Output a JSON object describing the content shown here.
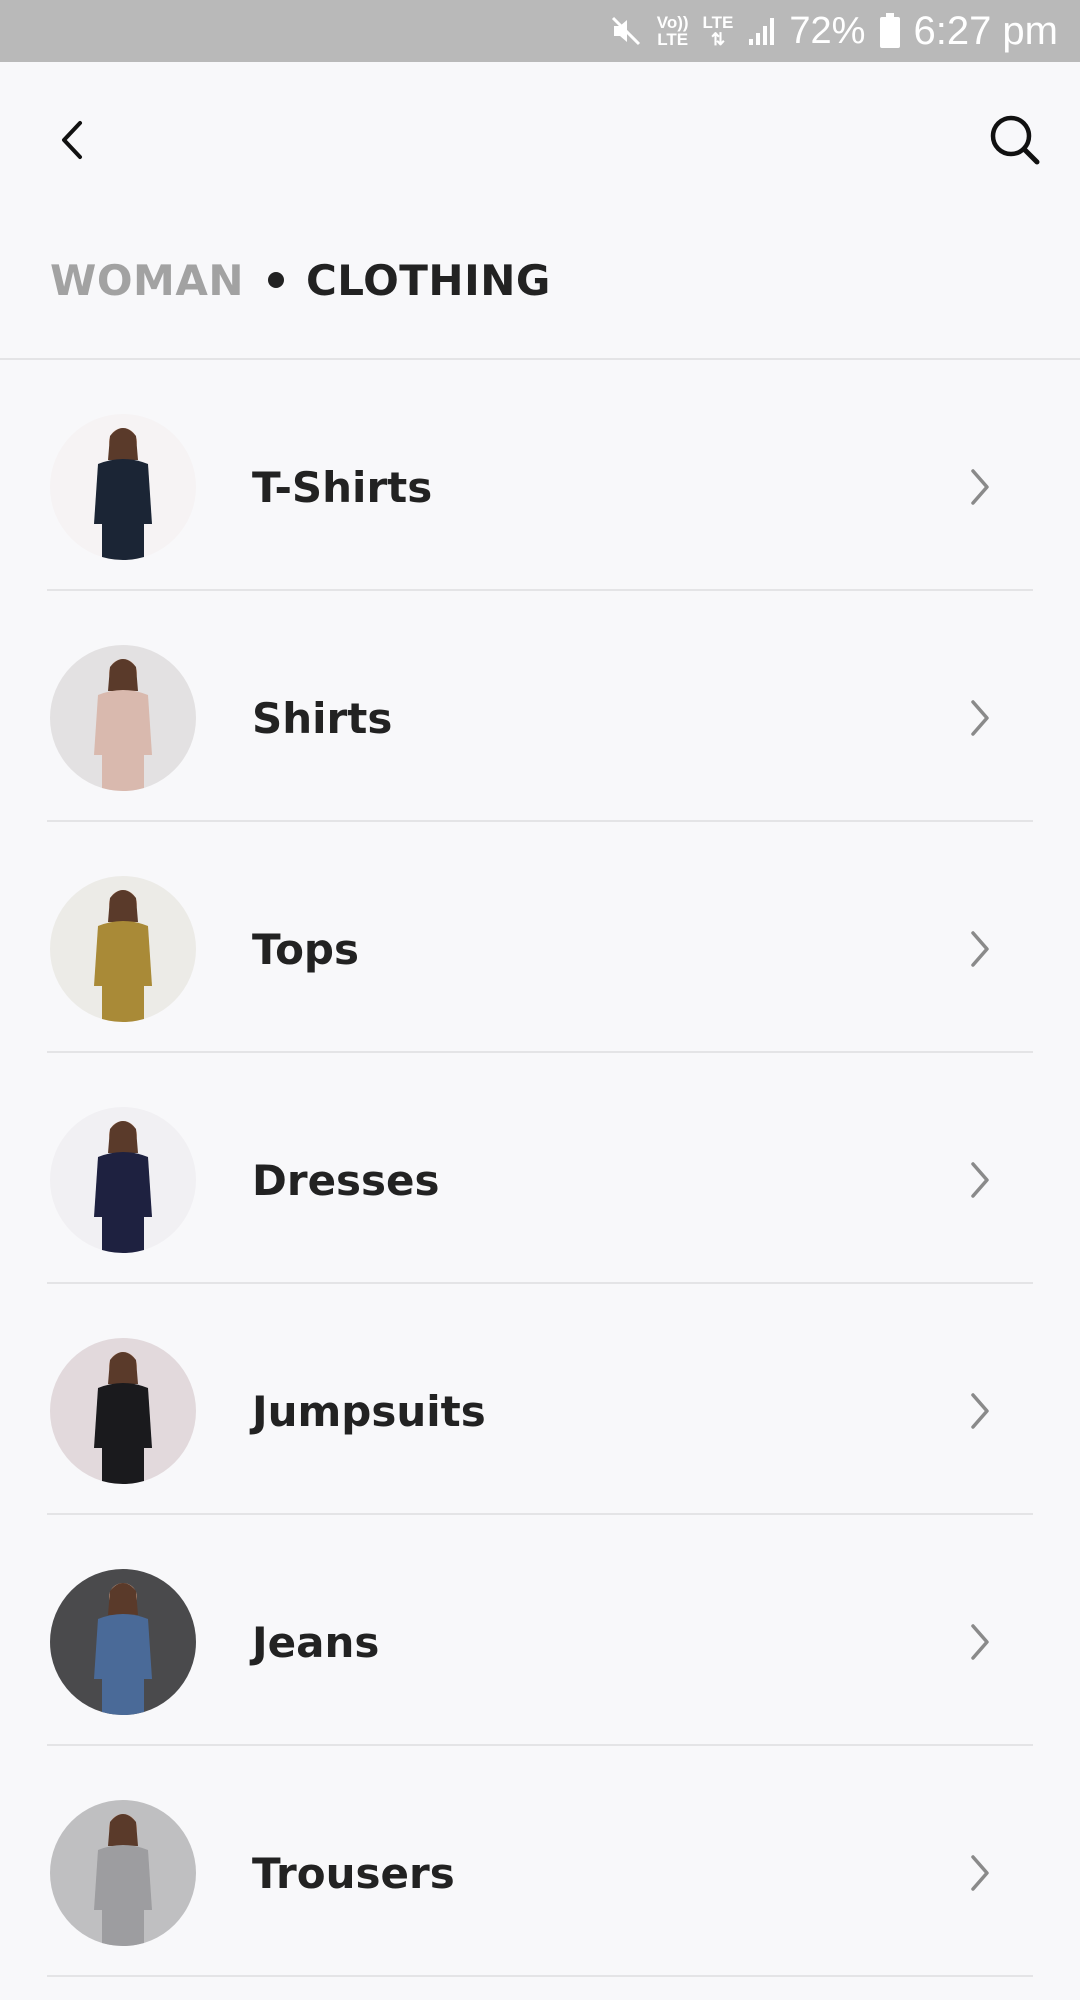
{
  "status_bar": {
    "volte_top": "Vo))",
    "volte_bottom": "LTE",
    "lte": "LTE",
    "battery": "72%",
    "time": "6:27 pm"
  },
  "header": {
    "back_icon": "chevron-left-icon",
    "search_icon": "search-icon"
  },
  "breadcrumb": {
    "parent": "WOMAN",
    "current": "CLOTHING"
  },
  "categories": [
    {
      "label": "T-Shirts",
      "icon": "chevron-right-icon",
      "thumb_bg": "#f6f3f4",
      "garment": "#1b2535"
    },
    {
      "label": "Shirts",
      "icon": "chevron-right-icon",
      "thumb_bg": "#e3e1e2",
      "garment": "#d9b9ae"
    },
    {
      "label": "Tops",
      "icon": "chevron-right-icon",
      "thumb_bg": "#ecebe7",
      "garment": "#a98a37"
    },
    {
      "label": "Dresses",
      "icon": "chevron-right-icon",
      "thumb_bg": "#f1f0f3",
      "garment": "#1e2140"
    },
    {
      "label": "Jumpsuits",
      "icon": "chevron-right-icon",
      "thumb_bg": "#e2d9dc",
      "garment": "#1a1a1d"
    },
    {
      "label": "Jeans",
      "icon": "chevron-right-icon",
      "thumb_bg": "#4a4a4c",
      "garment": "#4a6a98"
    },
    {
      "label": "Trousers",
      "icon": "chevron-right-icon",
      "thumb_bg": "#bfbfc1",
      "garment": "#9d9da0"
    }
  ],
  "colors": {
    "background": "#f8f8fa",
    "status_bar": "#b9b9b9",
    "text_primary": "#222222",
    "text_muted": "#a2a2a2",
    "divider": "#e4e4e6",
    "chevron": "#8a8a8a"
  }
}
